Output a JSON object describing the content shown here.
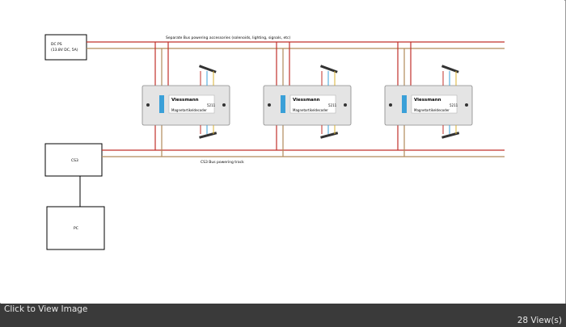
{
  "diagram": {
    "dcps_label_line1": "DC PS",
    "dcps_label_line2": "(13.8V DC, 5A)",
    "accessory_bus_label": "Separate Bus powering accessories (solenoids, lighting, signals, etc)",
    "cs3_label": "CS3",
    "track_bus_label": "CS3 Bus powering track",
    "pc_label": "PC",
    "decoders": [
      {
        "brand": "Viessmann",
        "model": "5211",
        "name": "Magnetartikeldecoder"
      },
      {
        "brand": "Viessmann",
        "model": "5211",
        "name": "Magnetartikeldecoder"
      },
      {
        "brand": "Viessmann",
        "model": "5211",
        "name": "Magnetartikeldecoder"
      }
    ],
    "colors": {
      "wire_red": "#c0302a",
      "wire_brown": "#b08a5a",
      "decoder_fill": "#e4e4e4",
      "dip_blue": "#3aa0d8"
    }
  },
  "footer": {
    "view_link": "Click to View Image",
    "views": "28 View(s)"
  }
}
